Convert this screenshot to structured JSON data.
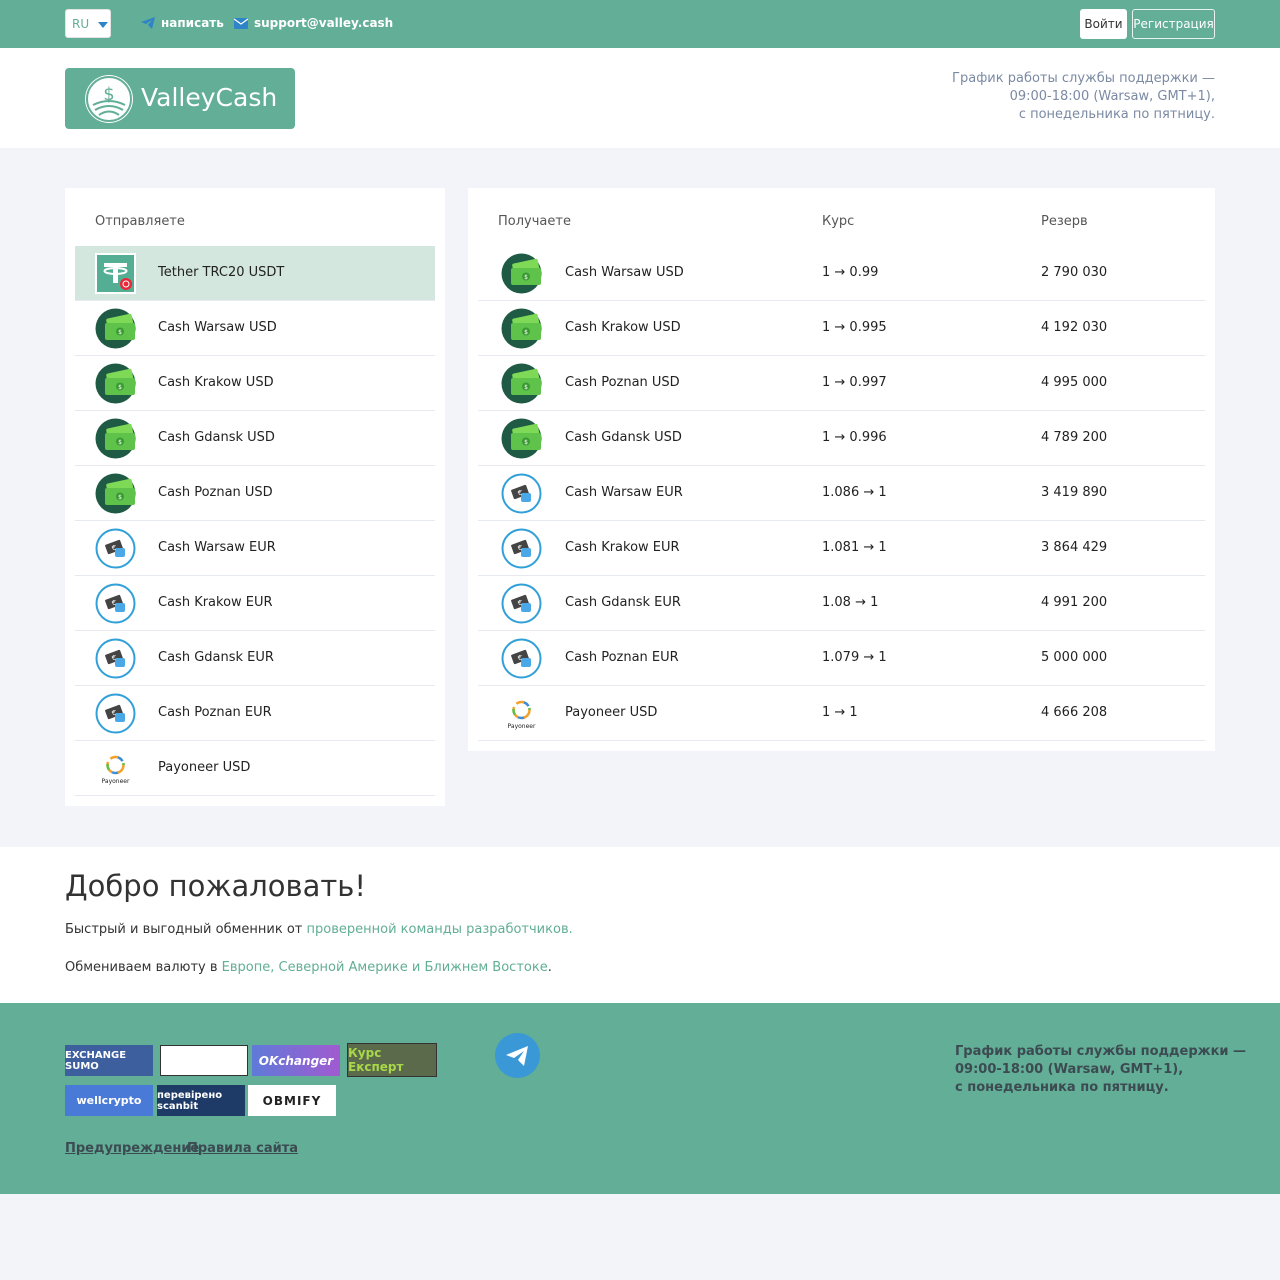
{
  "topbar": {
    "lang": "RU",
    "write_label": "написать",
    "email": "support@valley.cash",
    "login": "Войти",
    "register": "Регистрация"
  },
  "header": {
    "logo_text": "ValleyCash",
    "schedule_lines": [
      "График работы службы поддержки —",
      "09:00-18:00 (Warsaw, GMT+1),",
      "с понедельника по пятницу."
    ]
  },
  "send": {
    "heading": "Отправляете",
    "items": [
      {
        "label": "Tether TRC20 USDT",
        "icon": "tether-icon"
      },
      {
        "label": "Cash Warsaw USD",
        "icon": "cash-usd-icon"
      },
      {
        "label": "Cash Krakow USD",
        "icon": "cash-usd-icon"
      },
      {
        "label": "Cash Gdansk USD",
        "icon": "cash-usd-icon"
      },
      {
        "label": "Cash Poznan USD",
        "icon": "cash-usd-icon"
      },
      {
        "label": "Cash Warsaw EUR",
        "icon": "cash-eur-icon"
      },
      {
        "label": "Cash Krakow EUR",
        "icon": "cash-eur-icon"
      },
      {
        "label": "Cash Gdansk EUR",
        "icon": "cash-eur-icon"
      },
      {
        "label": "Cash Poznan EUR",
        "icon": "cash-eur-icon"
      },
      {
        "label": "Payoneer USD",
        "icon": "payoneer-icon"
      }
    ]
  },
  "receive": {
    "heading": "Получаете",
    "rate_heading": "Курс",
    "reserve_heading": "Резерв",
    "items": [
      {
        "label": "Cash Warsaw USD",
        "rate": "1 → 0.99",
        "reserve": "2 790 030",
        "icon": "cash-usd-icon"
      },
      {
        "label": "Cash Krakow USD",
        "rate": "1 → 0.995",
        "reserve": "4 192 030",
        "icon": "cash-usd-icon"
      },
      {
        "label": "Cash Poznan USD",
        "rate": "1 → 0.997",
        "reserve": "4 995 000",
        "icon": "cash-usd-icon"
      },
      {
        "label": "Cash Gdansk USD",
        "rate": "1 → 0.996",
        "reserve": "4 789 200",
        "icon": "cash-usd-icon"
      },
      {
        "label": "Cash Warsaw EUR",
        "rate": "1.086 → 1",
        "reserve": "3 419 890",
        "icon": "cash-eur-icon"
      },
      {
        "label": "Cash Krakow EUR",
        "rate": "1.081 → 1",
        "reserve": "3 864 429",
        "icon": "cash-eur-icon"
      },
      {
        "label": "Cash Gdansk EUR",
        "rate": "1.08 → 1",
        "reserve": "4 991 200",
        "icon": "cash-eur-icon"
      },
      {
        "label": "Cash Poznan EUR",
        "rate": "1.079 → 1",
        "reserve": "5 000 000",
        "icon": "cash-eur-icon"
      },
      {
        "label": "Payoneer USD",
        "rate": "1 → 1",
        "reserve": "4 666 208",
        "icon": "payoneer-icon"
      }
    ]
  },
  "welcome": {
    "title": "Добро пожаловать!",
    "line1_prefix": "Быстрый и выгодный обменник от ",
    "line1_link": "проверенной команды разработчиков.",
    "line2_prefix": "Обмениваем валюту в ",
    "line2_link": "Европе, Северной Америке и Ближнем Востоке",
    "line2_suffix": "."
  },
  "footer": {
    "badges": [
      "EXCHANGE SUMO",
      "OKchanger",
      "Курс Експерт",
      "wellcrypto",
      "перевірено scanbit",
      "OBMIFY"
    ],
    "payoneer_text": "Payoneer",
    "schedule_lines": [
      "График работы службы поддержки —",
      "09:00-18:00 (Warsaw, GMT+1),",
      "с понедельника по пятницу."
    ],
    "warning": "Предупреждение",
    "rules": "Правила сайта"
  },
  "colors": {
    "brand": "#62ae96",
    "active_row": "#d3e7df",
    "telegram": "#3a98d6"
  }
}
